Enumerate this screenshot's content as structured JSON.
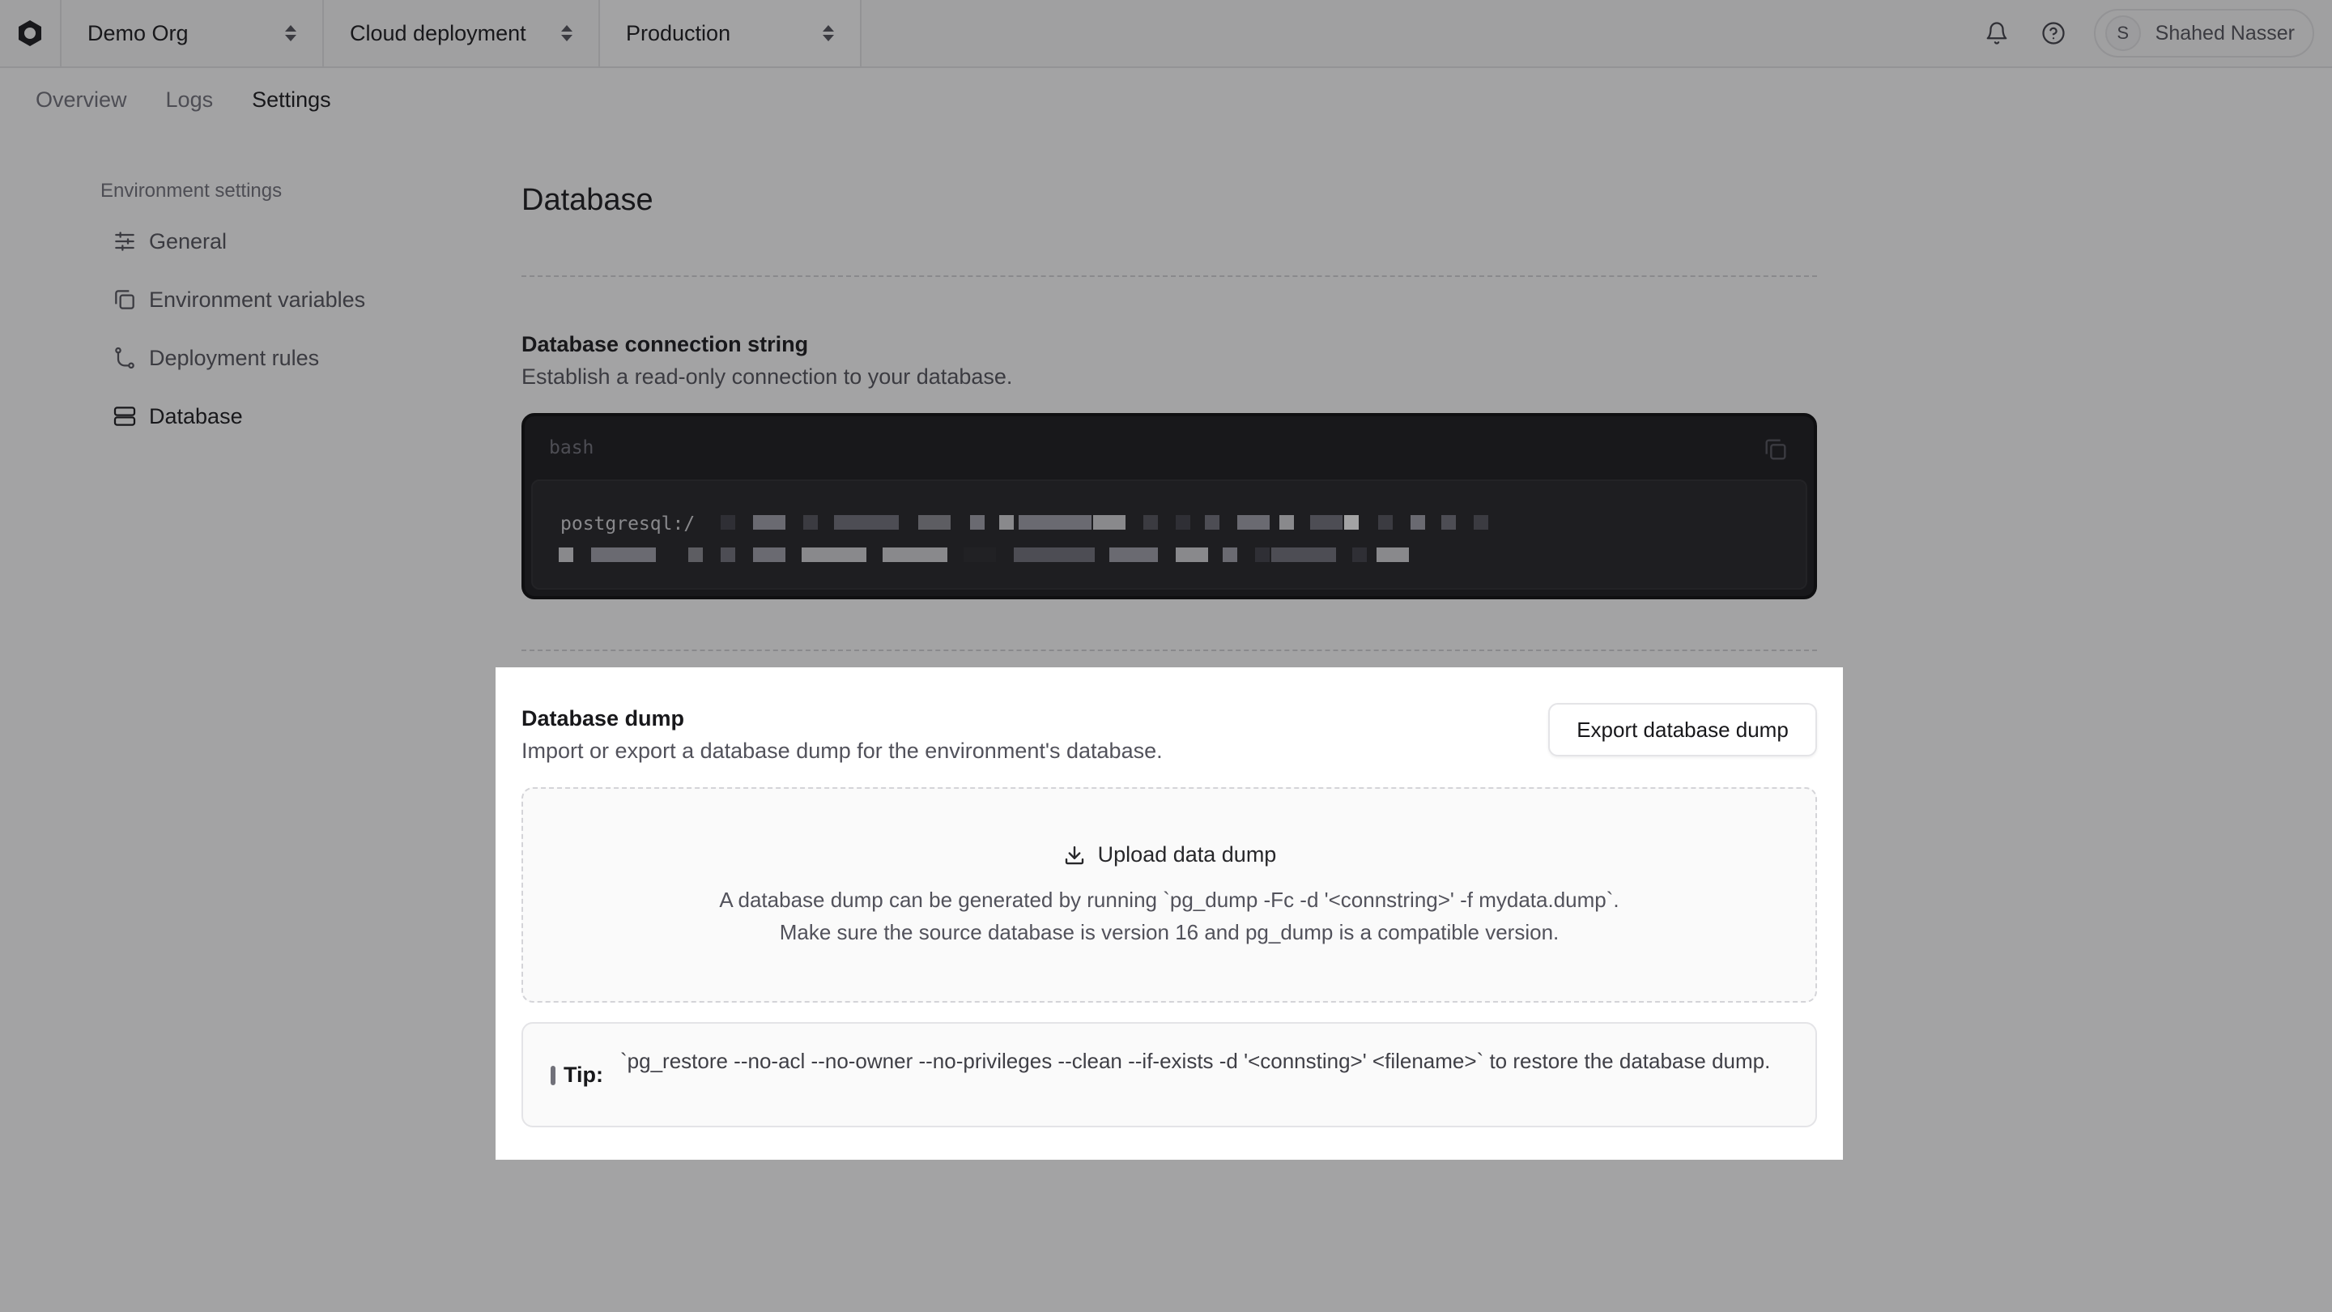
{
  "topbar": {
    "org": "Demo Org",
    "project": "Cloud deployment",
    "environment": "Production",
    "user_initial": "S",
    "user_name": "Shahed Nasser"
  },
  "tabs": [
    {
      "label": "Overview"
    },
    {
      "label": "Logs"
    },
    {
      "label": "Settings"
    }
  ],
  "sidebar": {
    "title": "Environment settings",
    "items": [
      {
        "label": "General",
        "icon": "sliders-icon"
      },
      {
        "label": "Environment variables",
        "icon": "copy-icon"
      },
      {
        "label": "Deployment rules",
        "icon": "git-branch-icon"
      },
      {
        "label": "Database",
        "icon": "database-icon"
      }
    ]
  },
  "main": {
    "title": "Database",
    "connection": {
      "title": "Database connection string",
      "description": "Establish a read-only connection to your database.",
      "language": "bash",
      "code_prefix": "postgresql:/"
    },
    "dump": {
      "title": "Database dump",
      "description": "Import or export a database dump for the environment's database.",
      "export_label": "Export database dump",
      "upload_label": "Upload data dump",
      "upload_hint_1": "A database dump can be generated by running `pg_dump -Fc -d '<connstring>' -f mydata.dump`.",
      "upload_hint_2": "Make sure the source database is version 16 and pg_dump is a compatible version.",
      "tip_label": "Tip:",
      "tip_text": "`pg_restore --no-acl --no-owner --no-privileges --clean --if-exists -d '<connsting>' <filename>` to restore the database dump."
    }
  },
  "colors": {
    "overlay": "#18181b",
    "code_bg": "#18181b",
    "border": "#e4e4e7"
  }
}
